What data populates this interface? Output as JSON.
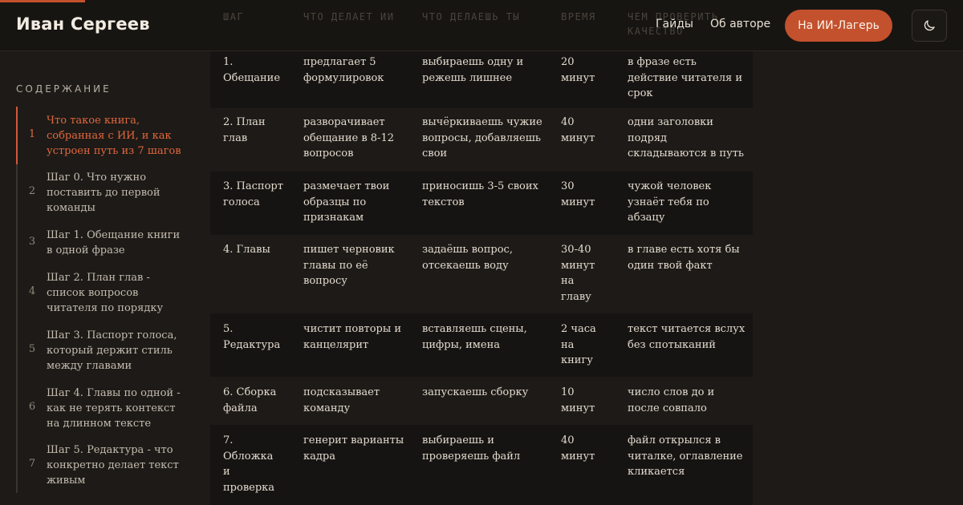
{
  "header": {
    "brand": "Иван Сергеев",
    "nav": [
      "Гайды",
      "Об авторе"
    ],
    "cta": "На ИИ-Лагерь",
    "theme_icon": "moon-icon"
  },
  "table": {
    "columns": [
      "ШАГ",
      "ЧТО ДЕЛАЕТ ИИ",
      "ЧТО ДЕЛАЕШЬ ТЫ",
      "ВРЕМЯ",
      "ЧЕМ ПРОВЕРИТЬ КАЧЕСТВО"
    ],
    "rows": [
      [
        "1. Обещание",
        "предлагает 5 формулировок",
        "выбираешь одну и режешь лишнее",
        "20 минут",
        "в фразе есть действие читателя и срок"
      ],
      [
        "2. План глав",
        "разворачивает обещание в 8-12 вопросов",
        "вычёркиваешь чужие вопросы, добавляешь свои",
        "40 минут",
        "одни заголовки подряд складываются в путь"
      ],
      [
        "3. Паспорт голоса",
        "размечает твои образцы по признакам",
        "приносишь 3-5 своих текстов",
        "30 минут",
        "чужой человек узнаёт тебя по абзацу"
      ],
      [
        "4. Главы",
        "пишет черновик главы по её вопросу",
        "задаёшь вопрос, отсекаешь воду",
        "30-40 минут на главу",
        "в главе есть хотя бы один твой факт"
      ],
      [
        "5. Редактура",
        "чистит повторы и канцелярит",
        "вставляешь сцены, цифры, имена",
        "2 часа на книгу",
        "текст читается вслух без спотыканий"
      ],
      [
        "6. Сборка файла",
        "подсказывает команду",
        "запускаешь сборку",
        "10 минут",
        "число слов до и после совпало"
      ],
      [
        "7. Обложка и проверка",
        "генерит варианты кадра",
        "выбираешь и проверяешь файл",
        "40 минут",
        "файл открылся в читалке, оглавление кликается"
      ]
    ]
  },
  "toc": {
    "title": "СОДЕРЖАНИЕ",
    "items": [
      {
        "num": "1",
        "label": "Что такое книга, собранная с ИИ, и как устроен путь из 7 шагов"
      },
      {
        "num": "2",
        "label": "Шаг 0. Что нужно поставить до первой команды"
      },
      {
        "num": "3",
        "label": "Шаг 1. Обещание книги в одной фразе"
      },
      {
        "num": "4",
        "label": "Шаг 2. План глав - список вопросов читателя по порядку"
      },
      {
        "num": "5",
        "label": "Шаг 3. Паспорт голоса, который держит стиль между главами"
      },
      {
        "num": "6",
        "label": "Шаг 4. Главы по одной - как не терять контекст на длинном тексте"
      },
      {
        "num": "7",
        "label": "Шаг 5. Редактура - что конкретно делает текст живым"
      }
    ]
  },
  "colors": {
    "accent": "#c3512d",
    "background": "#1d1a17",
    "active_toc": "#e0673d"
  }
}
